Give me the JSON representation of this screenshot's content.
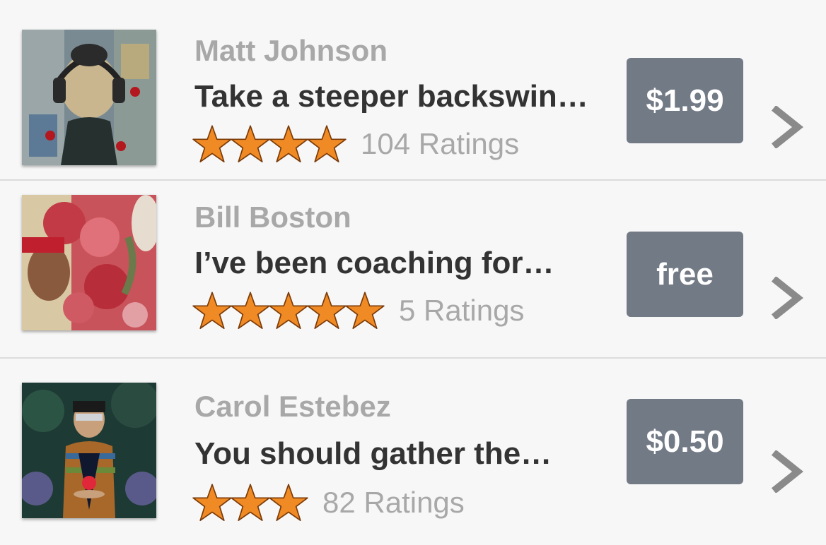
{
  "colors": {
    "star_fill": "#f08a24",
    "price_button": "#727a85",
    "author_text": "#a8a8a8",
    "snippet_text": "#333333",
    "chevron": "#8a8a8a"
  },
  "items": [
    {
      "author": "Matt Johnson",
      "snippet": "Take a steeper backswin…",
      "stars": 4,
      "ratings": "104 Ratings",
      "price": "$1.99",
      "thumbnail": "painting of figure with headphones"
    },
    {
      "author": "Bill Boston",
      "snippet": "I’ve been coaching for…",
      "stars": 5,
      "ratings": "5 Ratings",
      "price": "free",
      "thumbnail": "painting of woman with red roses"
    },
    {
      "author": "Carol Estebez",
      "snippet": "You should gather the…",
      "stars": 3,
      "ratings": "82 Ratings",
      "price": "$0.50",
      "thumbnail": "painting of boy holding glowing orb"
    }
  ]
}
